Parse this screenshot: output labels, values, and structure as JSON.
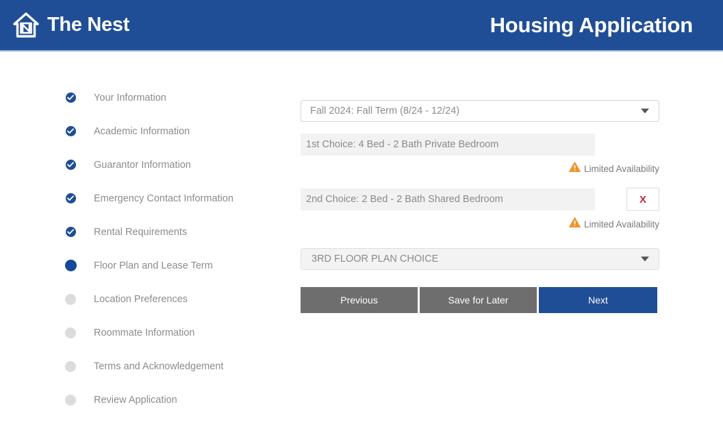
{
  "header": {
    "brand_name": "The Nest",
    "brand_icon": "house-nest-logo-icon",
    "title": "Housing Application"
  },
  "sidebar": {
    "items": [
      {
        "label": "Your Information",
        "state": "done",
        "icon": "check-circle-icon"
      },
      {
        "label": "Academic Information",
        "state": "done",
        "icon": "check-circle-icon"
      },
      {
        "label": "Guarantor Information",
        "state": "done",
        "icon": "check-circle-icon"
      },
      {
        "label": "Emergency Contact Information",
        "state": "done",
        "icon": "check-circle-icon"
      },
      {
        "label": "Rental Requirements",
        "state": "done",
        "icon": "check-circle-icon"
      },
      {
        "label": "Floor Plan and Lease Term",
        "state": "current",
        "icon": "filled-circle-icon"
      },
      {
        "label": "Location Preferences",
        "state": "todo",
        "icon": "empty-circle-icon"
      },
      {
        "label": "Roommate Information",
        "state": "todo",
        "icon": "empty-circle-icon"
      },
      {
        "label": "Terms and Acknowledgement",
        "state": "todo",
        "icon": "empty-circle-icon"
      },
      {
        "label": "Review Application",
        "state": "todo",
        "icon": "empty-circle-icon"
      }
    ]
  },
  "form": {
    "term_select": {
      "value": "Fall 2024: Fall Term (8/24 - 12/24)",
      "caret_icon": "chevron-down-icon"
    },
    "choices": [
      {
        "text": "1st Choice: 4 Bed - 2 Bath Private Bedroom",
        "availability": "Limited Availability",
        "warning_icon": "warning-triangle-icon",
        "has_remove": false,
        "remove_label": ""
      },
      {
        "text": "2nd Choice: 2 Bed - 2 Bath Shared Bedroom",
        "availability": "Limited Availability",
        "warning_icon": "warning-triangle-icon",
        "has_remove": true,
        "remove_label": "X"
      }
    ],
    "third_choice_select": {
      "value": "3RD FLOOR PLAN CHOICE",
      "caret_icon": "chevron-down-icon"
    },
    "buttons": {
      "previous": "Previous",
      "save": "Save for Later",
      "next": "Next"
    }
  },
  "colors": {
    "brand_blue": "#1f4e96",
    "warning_orange": "#f0922b",
    "remove_red": "#c42b3c",
    "button_gray": "#6e6e6e"
  }
}
